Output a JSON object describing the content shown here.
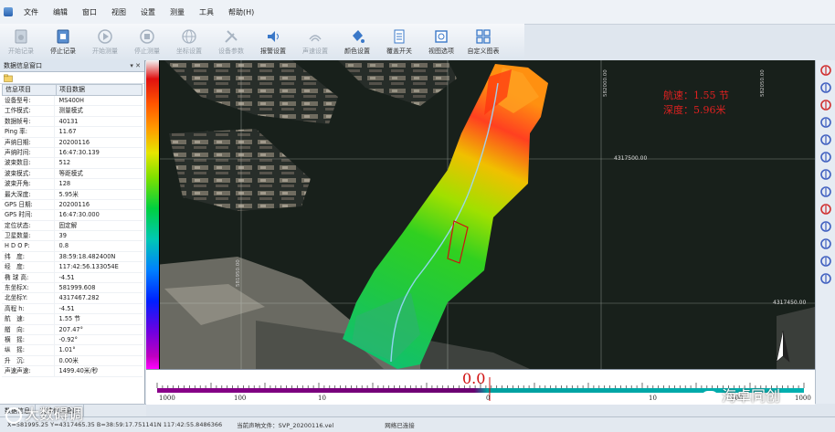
{
  "menu": [
    "文件",
    "编辑",
    "窗口",
    "视图",
    "设置",
    "测量",
    "工具",
    "帮助(H)"
  ],
  "toolbar": [
    {
      "label": "开始记录",
      "icon": "record-start-icon",
      "enabled": false
    },
    {
      "label": "停止记录",
      "icon": "record-stop-icon",
      "enabled": true
    },
    {
      "label": "开始测量",
      "icon": "play-icon",
      "enabled": false
    },
    {
      "label": "停止测量",
      "icon": "stop-icon",
      "enabled": false
    },
    {
      "label": "坐标设置",
      "icon": "globe-icon",
      "enabled": false
    },
    {
      "label": "设备参数",
      "icon": "tools-icon",
      "enabled": false
    },
    {
      "label": "报警设置",
      "icon": "speaker-icon",
      "enabled": true
    },
    {
      "label": "声速设置",
      "icon": "sound-wave-icon",
      "enabled": false
    },
    {
      "label": "颜色设置",
      "icon": "paint-bucket-icon",
      "enabled": true
    },
    {
      "label": "覆盖开关",
      "icon": "document-icon",
      "enabled": true
    },
    {
      "label": "视图选项",
      "icon": "view-options-icon",
      "enabled": true
    },
    {
      "label": "自定义图表",
      "icon": "grid-icon",
      "enabled": true
    }
  ],
  "panel": {
    "title": "数据信息窗口",
    "controls": "▾ ✕",
    "header": {
      "col1": "信息项目",
      "col2": "项目数据"
    },
    "rows": [
      [
        "设备型号:",
        "MS400H"
      ],
      [
        "工作模式:",
        "测量模式"
      ],
      [
        "数据帧号:",
        "40131"
      ],
      [
        "Ping 率:",
        "11.67"
      ],
      [
        "声纳日期:",
        "20200116"
      ],
      [
        "声纳时间:",
        "16:47:30.139"
      ],
      [
        "波束数目:",
        "512"
      ],
      [
        "波束模式:",
        "等距模式"
      ],
      [
        "波束开角:",
        "128"
      ],
      [
        "最大深度:",
        "5.95米"
      ],
      [
        "GPS 日期:",
        "20200116"
      ],
      [
        "GPS 时间:",
        "16:47:30.000"
      ],
      [
        "定位状态:",
        "固定解"
      ],
      [
        "卫星数量:",
        "39"
      ],
      [
        "H D O P:",
        "0.8"
      ],
      [
        "纬　度:",
        "38:59:18.482400N"
      ],
      [
        "经　度:",
        "117:42:56.133054E"
      ],
      [
        "椭 球 高:",
        "-4.51"
      ],
      [
        "东坐标X:",
        "581999.608"
      ],
      [
        "北坐标Y:",
        "4317467.282"
      ],
      [
        "高程 h:",
        "-4.51"
      ],
      [
        "航　速:",
        "1.55 节"
      ],
      [
        "艏　向:",
        "207.47°"
      ],
      [
        "横　摇:",
        "-0.92°"
      ],
      [
        "纵　摇:",
        "1.01°"
      ],
      [
        "升　沉:",
        "0.00米"
      ],
      [
        "声速声速:",
        "1499.40米/秒"
      ]
    ],
    "tabs": [
      "数据信息",
      "文件信息窗口"
    ]
  },
  "map": {
    "speed_text": "航速：1.55 节",
    "depth_text": "深度：5.96米",
    "grid_labels": [
      "4317500.00",
      "4317450.00",
      "581950.00",
      "582000.00",
      "582050.00"
    ],
    "north": "N"
  },
  "scale": {
    "center_value": "0.0",
    "ticks": [
      "1000",
      "100",
      "10",
      "0",
      "10",
      "100",
      "1000"
    ]
  },
  "status": {
    "coords": "X=581995.25 Y=4317465.35 B=38:59:17.751141N 117:42:55.8486366",
    "file": "当前声呐文件：SVP_20200116.vel",
    "net": "网络已连接"
  },
  "watermark": {
    "left": "大数碍调",
    "right": "海卓同创"
  }
}
